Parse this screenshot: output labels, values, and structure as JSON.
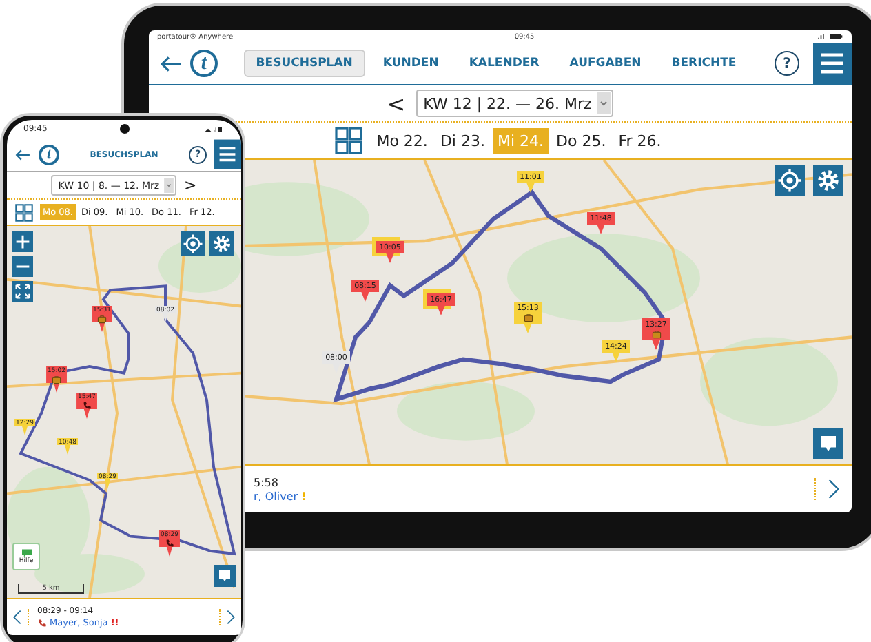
{
  "tablet": {
    "status_bar": {
      "carrier": "portatour® Anywhere",
      "time": "09:45"
    },
    "logo": "t",
    "help": "?",
    "tabs": [
      {
        "label": "BESUCHSPLAN",
        "selected": true
      },
      {
        "label": "KUNDEN",
        "selected": false
      },
      {
        "label": "KALENDER",
        "selected": false
      },
      {
        "label": "AUFGABEN",
        "selected": false
      },
      {
        "label": "BERICHTE",
        "selected": false
      }
    ],
    "week": {
      "prev": "<",
      "label": "KW 12 | 22. — 26. Mrz"
    },
    "days": [
      {
        "label": "Mo 22.",
        "selected": false
      },
      {
        "label": "Di 23.",
        "selected": false
      },
      {
        "label": "Mi 24.",
        "selected": true
      },
      {
        "label": "Do 25.",
        "selected": false
      },
      {
        "label": "Fr 26.",
        "selected": false
      }
    ],
    "pins": [
      {
        "time": "11:01",
        "color": "#f6d23c",
        "stacked": false
      },
      {
        "time": "11:48",
        "color": "#f04a4a",
        "stacked": false
      },
      {
        "time": "10:05",
        "color": "#f04a4a",
        "stacked": true
      },
      {
        "time": "08:15",
        "color": "#f04a4a",
        "stacked": false
      },
      {
        "time": "16:47",
        "color": "#f04a4a",
        "stacked": true
      },
      {
        "time": "15:13",
        "color": "#f6d23c",
        "stacked": false,
        "kind": "bag"
      },
      {
        "time": "13:27",
        "color": "#f04a4a",
        "stacked": false,
        "kind": "bag"
      },
      {
        "time": "14:24",
        "color": "#f6d23c",
        "stacked": false
      },
      {
        "time": "08:00",
        "color": "#e6e6e6",
        "stacked": false
      }
    ],
    "appointment": {
      "time": "5:58",
      "name": "r, Oliver",
      "alert": "!"
    }
  },
  "phone": {
    "status_bar": {
      "time": "09:45"
    },
    "logo": "t",
    "help": "?",
    "title": "BESUCHSPLAN",
    "week": {
      "label": "KW 10 | 8. — 12. Mrz",
      "next": ">"
    },
    "days": [
      {
        "label": "Mo 08.",
        "selected": true
      },
      {
        "label": "Di 09.",
        "selected": false
      },
      {
        "label": "Mi 10.",
        "selected": false
      },
      {
        "label": "Do 11.",
        "selected": false
      },
      {
        "label": "Fr 12.",
        "selected": false
      }
    ],
    "pins": [
      {
        "time": "15:31",
        "color": "#f04a4a",
        "kind": "bag"
      },
      {
        "time": "08:02",
        "color": "#e6e6e6"
      },
      {
        "time": "15:02",
        "color": "#f04a4a",
        "kind": "bag"
      },
      {
        "time": "15:47",
        "color": "#f04a4a",
        "kind": "phone"
      },
      {
        "time": "12:29",
        "color": "#f6d23c"
      },
      {
        "time": "10:48",
        "color": "#f6d23c"
      },
      {
        "time": "08:29",
        "color": "#f6d23c"
      },
      {
        "time": "08:29",
        "color": "#f04a4a",
        "kind": "phone"
      }
    ],
    "help_label": "Hilfe",
    "scale": "5 km",
    "appointment": {
      "time": "08:29 - 09:14",
      "name": "Mayer, Sonja",
      "alert": "!!"
    }
  }
}
